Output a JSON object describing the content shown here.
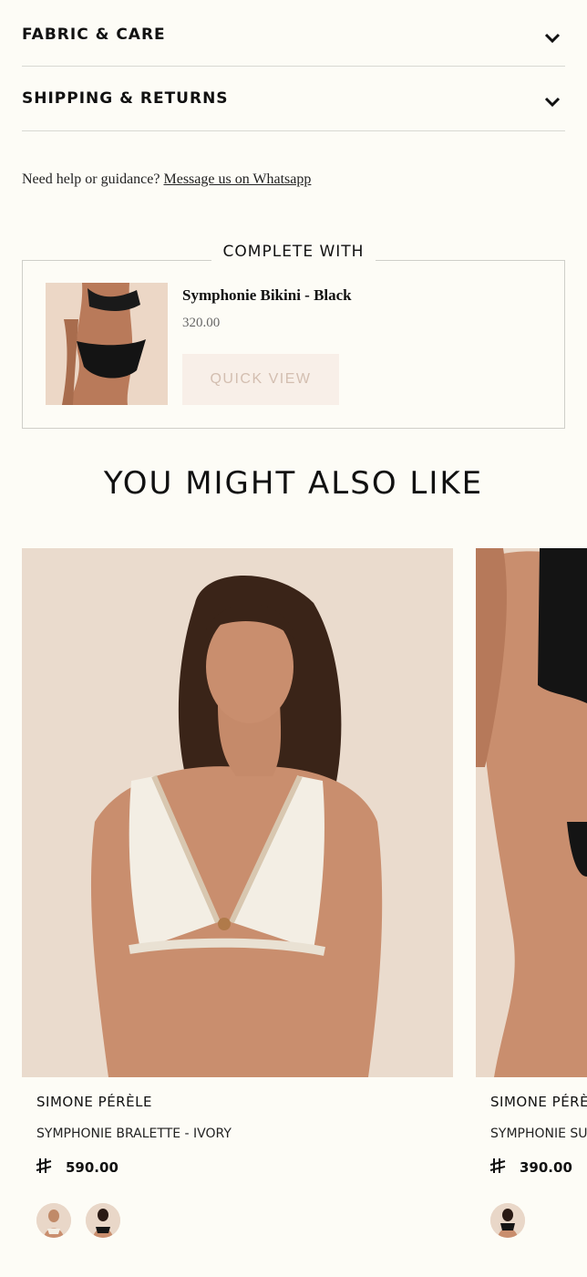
{
  "accordions": [
    {
      "label": "FABRIC & CARE"
    },
    {
      "label": "SHIPPING & RETURNS"
    }
  ],
  "help": {
    "text": "Need help or guidance?",
    "link": "Message us on Whatsapp"
  },
  "complete_with": {
    "title": "COMPLETE WITH",
    "product_name": "Symphonie Bikini - Black",
    "price": "320.00",
    "quick_view": "QUICK VIEW"
  },
  "recommendations": {
    "title": "YOU MIGHT ALSO LIKE",
    "products": [
      {
        "brand": "SIMONE PÉRÈLE",
        "name": "SYMPHONIE BRALETTE - IVORY",
        "price": "590.00",
        "currency_symbol": "⃁"
      },
      {
        "brand": "SIMONE PÉRÈ",
        "name": "SYMPHONIE SU",
        "price": "390.00",
        "currency_symbol": "⃁"
      }
    ]
  },
  "colors": {
    "background": "#fdfcf6",
    "quick_view_bg": "#f8efe8",
    "quick_view_text": "#d3beb0"
  }
}
